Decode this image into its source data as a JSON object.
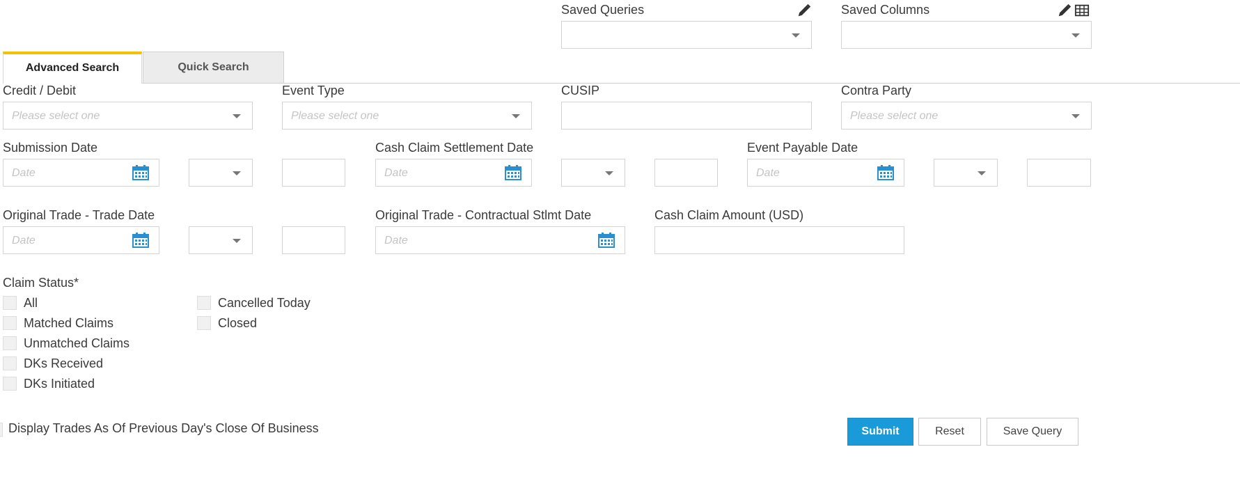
{
  "header": {
    "saved_queries_label": "Saved Queries",
    "saved_columns_label": "Saved Columns",
    "saved_queries_value": "",
    "saved_columns_value": ""
  },
  "tabs": [
    {
      "label": "Advanced Search",
      "active": true
    },
    {
      "label": "Quick Search",
      "active": false
    }
  ],
  "fields": {
    "credit_debit": {
      "label": "Credit / Debit",
      "placeholder": "Please select one"
    },
    "event_type": {
      "label": "Event Type",
      "placeholder": "Please select one"
    },
    "cusip": {
      "label": "CUSIP",
      "value": ""
    },
    "contra_party": {
      "label": "Contra Party",
      "placeholder": "Please select one"
    },
    "submission_date": {
      "label": "Submission Date",
      "placeholder": "Date"
    },
    "cash_claim_settlement_date": {
      "label": "Cash Claim Settlement Date",
      "placeholder": "Date"
    },
    "event_payable_date": {
      "label": "Event Payable Date",
      "placeholder": "Date"
    },
    "original_trade_date": {
      "label": "Original Trade - Trade Date",
      "placeholder": "Date"
    },
    "original_contractual_date": {
      "label": "Original Trade - Contractual Stlmt Date",
      "placeholder": "Date"
    },
    "cash_claim_amount": {
      "label": "Cash Claim Amount (USD)",
      "value": ""
    }
  },
  "claim_status": {
    "label": "Claim Status*",
    "options_col1": [
      "All",
      "Matched Claims",
      "Unmatched Claims",
      "DKs Received",
      "DKs Initiated"
    ],
    "options_col2": [
      "Cancelled Today",
      "Closed"
    ]
  },
  "previous_day": {
    "label": "Display Trades As Of Previous Day's Close Of Business"
  },
  "buttons": {
    "submit": "Submit",
    "reset": "Reset",
    "save_query": "Save Query"
  },
  "colors": {
    "accent": "#f2c200",
    "primary_button": "#1a9ad9",
    "calendar_icon": "#2a8fd0"
  }
}
